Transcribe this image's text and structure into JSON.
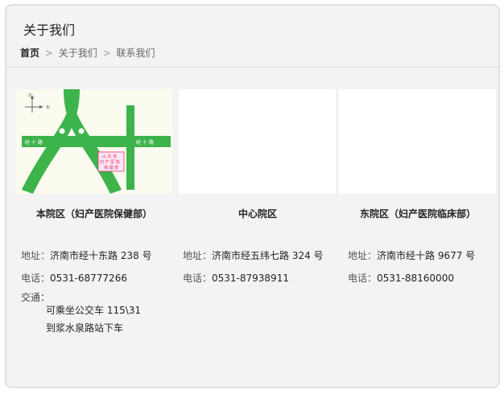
{
  "panel": {
    "title": "关于我们"
  },
  "breadcrumb": {
    "home": "首页",
    "separator": ">",
    "items": [
      "关于我们",
      "联系我们"
    ]
  },
  "campuses": [
    {
      "name": "本院区（妇产医院保健部）",
      "map": {
        "compass_n": "北",
        "compass_e": "东",
        "road_h": "经 十 路",
        "road_h_right": "经 十 路",
        "road_v": "燕 子 山 路",
        "hospital_label": [
          "山 东 省",
          "妇 产 医 院",
          "保 健 部"
        ]
      },
      "address_label": "地址：",
      "address": "济南市经十东路 238 号",
      "phone_label": "电话：",
      "phone": "0531-68777266",
      "transport_label": "交通：",
      "transport": [
        "可乘坐公交车 115\\31",
        "到浆水泉路站下车"
      ]
    },
    {
      "name": "中心院区",
      "address_label": "地址：",
      "address": "济南市经五纬七路 324 号",
      "phone_label": "电话：",
      "phone": "0531-87938911"
    },
    {
      "name": "东院区（妇产医院临床部）",
      "address_label": "地址：",
      "address": "济南市经十路 9677 号",
      "phone_label": "电话：",
      "phone": "0531-88160000"
    }
  ],
  "colors": {
    "road_green": "#3cb44b",
    "road_green_dark": "#2a9a3a",
    "label_pink": "#e0307a",
    "map_bg": "#fbfbef"
  }
}
